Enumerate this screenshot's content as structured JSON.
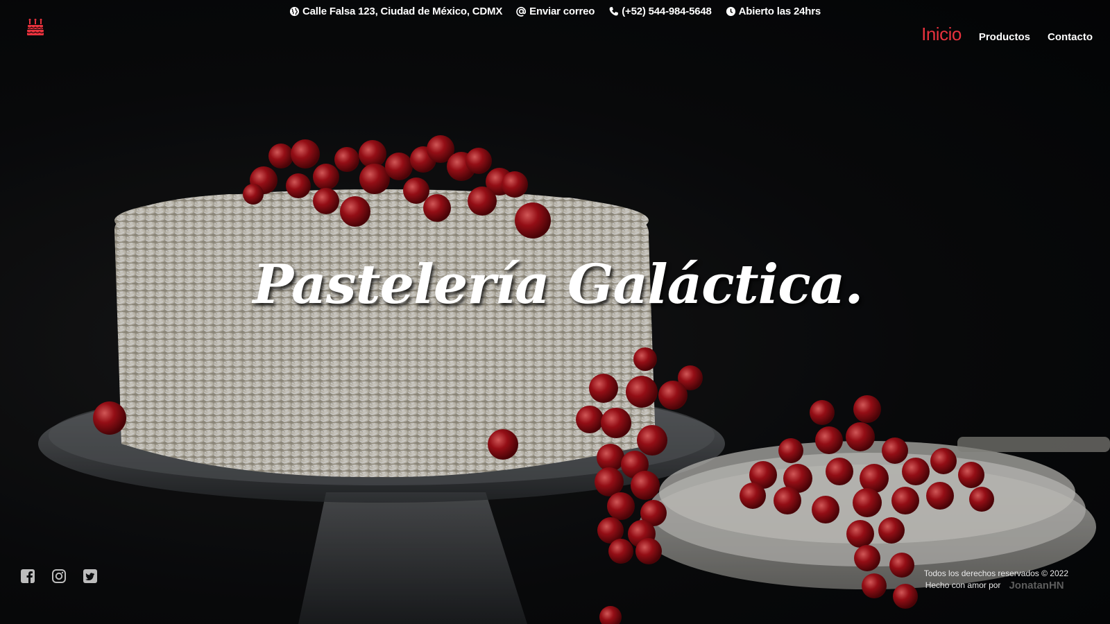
{
  "topbar": {
    "address": {
      "icon": "globe-icon",
      "text": "Calle Falsa 123, Ciudad de México, CDMX"
    },
    "email": {
      "icon": "at-sign-icon",
      "text": "Enviar correo"
    },
    "phone": {
      "icon": "phone-icon",
      "text": "(+52) 544-984-5648"
    },
    "hours": {
      "icon": "clock-icon",
      "text": "Abierto las 24hrs"
    }
  },
  "logo": {
    "icon": "birthday-cake-icon",
    "color": "#e7323d"
  },
  "nav": {
    "items": [
      {
        "label": "Inicio",
        "active": true
      },
      {
        "label": "Productos",
        "active": false
      },
      {
        "label": "Contacto",
        "active": false
      }
    ],
    "active_color": "#e7323d"
  },
  "hero": {
    "title": "Pastelería Galáctica."
  },
  "social": {
    "icons": [
      "facebook-icon",
      "instagram-icon",
      "twitter-icon"
    ],
    "color": "#bdbdbd"
  },
  "footer": {
    "copyright": "Todos los derechos reservados © 2022",
    "made_with": "Hecho con amor por",
    "author": "JonatanHN"
  }
}
